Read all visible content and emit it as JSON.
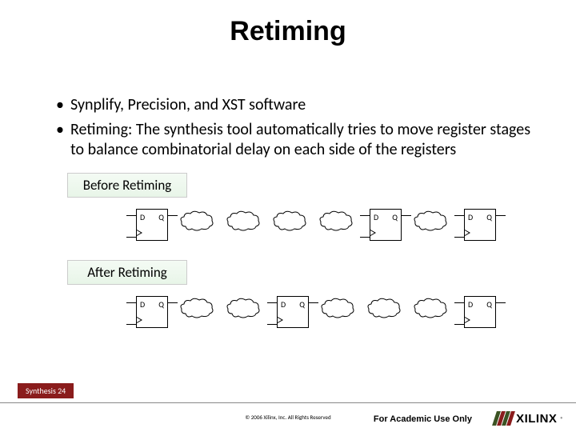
{
  "title": "Retiming",
  "bullets": [
    "Synplify, Precision, and XST software",
    "Retiming: The synthesis tool automatically tries to move register stages to balance combinatorial delay on each side of the registers"
  ],
  "labels": {
    "before": "Before Retiming",
    "after": "After Retiming"
  },
  "ff": {
    "d": "D",
    "q": "Q"
  },
  "footer": {
    "section": "Synthesis   24",
    "copyright": "© 2006 Xilinx, Inc. All Rights Reserved",
    "academic": "For Academic Use Only",
    "logo_text": "XILINX",
    "logo_r": "®"
  }
}
